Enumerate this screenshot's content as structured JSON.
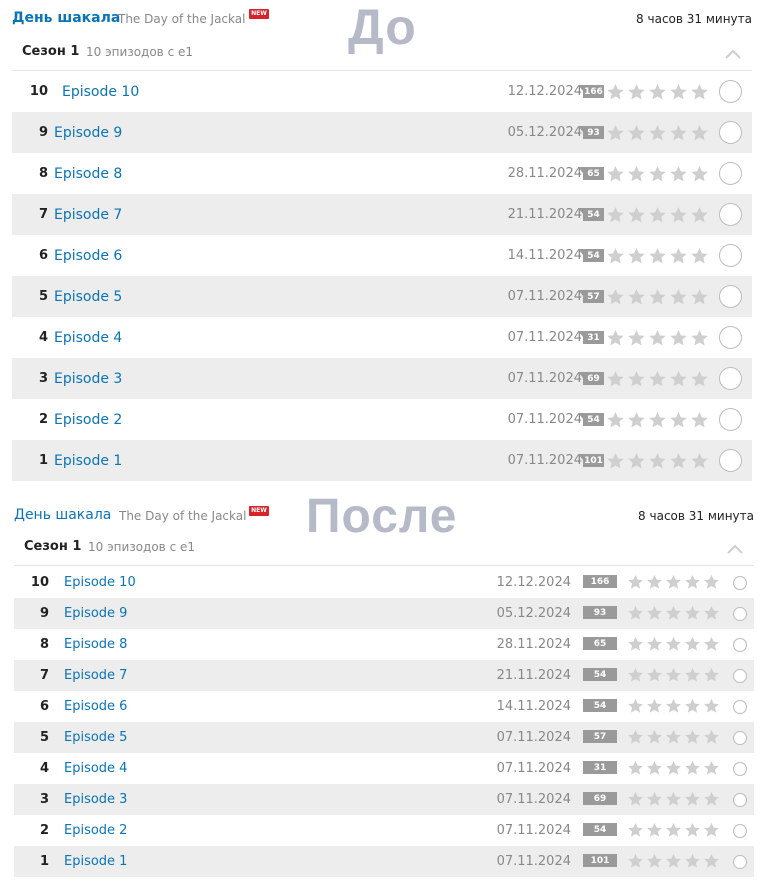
{
  "labels": {
    "before": "До",
    "after": "После"
  },
  "show": {
    "title_ru": "День шакала",
    "title_en": "The Day of the Jackal",
    "new_badge": "NEW",
    "duration": "8 часов 31 минута"
  },
  "season": {
    "title": "Сезон 1",
    "info": "10 эпизодов с e1"
  },
  "episodes": [
    {
      "num": "10",
      "name": "Episode 10",
      "date": "12.12.2024",
      "count": "166"
    },
    {
      "num": "9",
      "name": "Episode 9",
      "date": "05.12.2024",
      "count": "93"
    },
    {
      "num": "8",
      "name": "Episode 8",
      "date": "28.11.2024",
      "count": "65"
    },
    {
      "num": "7",
      "name": "Episode 7",
      "date": "21.11.2024",
      "count": "54"
    },
    {
      "num": "6",
      "name": "Episode 6",
      "date": "14.11.2024",
      "count": "54"
    },
    {
      "num": "5",
      "name": "Episode 5",
      "date": "07.11.2024",
      "count": "57"
    },
    {
      "num": "4",
      "name": "Episode 4",
      "date": "07.11.2024",
      "count": "31"
    },
    {
      "num": "3",
      "name": "Episode 3",
      "date": "07.11.2024",
      "count": "69"
    },
    {
      "num": "2",
      "name": "Episode 2",
      "date": "07.11.2024",
      "count": "54"
    },
    {
      "num": "1",
      "name": "Episode 1",
      "date": "07.11.2024",
      "count": "101"
    }
  ],
  "icons": {
    "star": "star-icon",
    "watched": "watched-circle-icon",
    "collapse": "chevron-up-icon"
  },
  "colors": {
    "link": "#0a74b6",
    "star": "#cfcfcf",
    "badge_new": "#d9222a",
    "count_bg": "#9a9a9a",
    "overlay_text": "#b5b9c8"
  }
}
